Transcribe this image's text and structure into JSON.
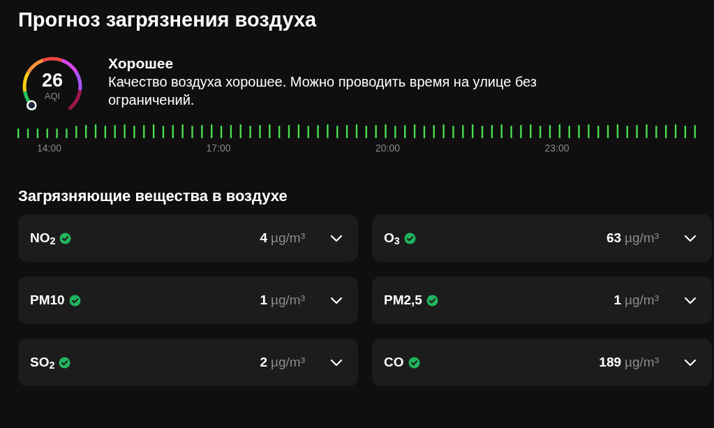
{
  "title": "Прогноз загрязнения воздуха",
  "aqi": {
    "value": "26",
    "unit": "AQI",
    "status": "Хорошее",
    "description": "Качество воздуха хорошее. Можно проводить время на улице без ограничений."
  },
  "timeline": {
    "labels": [
      "14:00",
      "17:00",
      "20:00",
      "23:00"
    ]
  },
  "pollutants_title": "Загрязняющие вещества в воздухе",
  "pollutants": [
    {
      "name": "NO$_{2}$",
      "ok": true,
      "value": "4",
      "unit": "µg/m³"
    },
    {
      "name": "O$_{3}$",
      "ok": true,
      "value": "63",
      "unit": "µg/m³"
    },
    {
      "name": "PM10",
      "ok": true,
      "value": "1",
      "unit": "µg/m³"
    },
    {
      "name": "PM2,5",
      "ok": true,
      "value": "1",
      "unit": "µg/m³"
    },
    {
      "name": "SO$_{2}$",
      "ok": true,
      "value": "2",
      "unit": "µg/m³"
    },
    {
      "name": "CO",
      "ok": true,
      "value": "189",
      "unit": "µg/m³"
    }
  ]
}
